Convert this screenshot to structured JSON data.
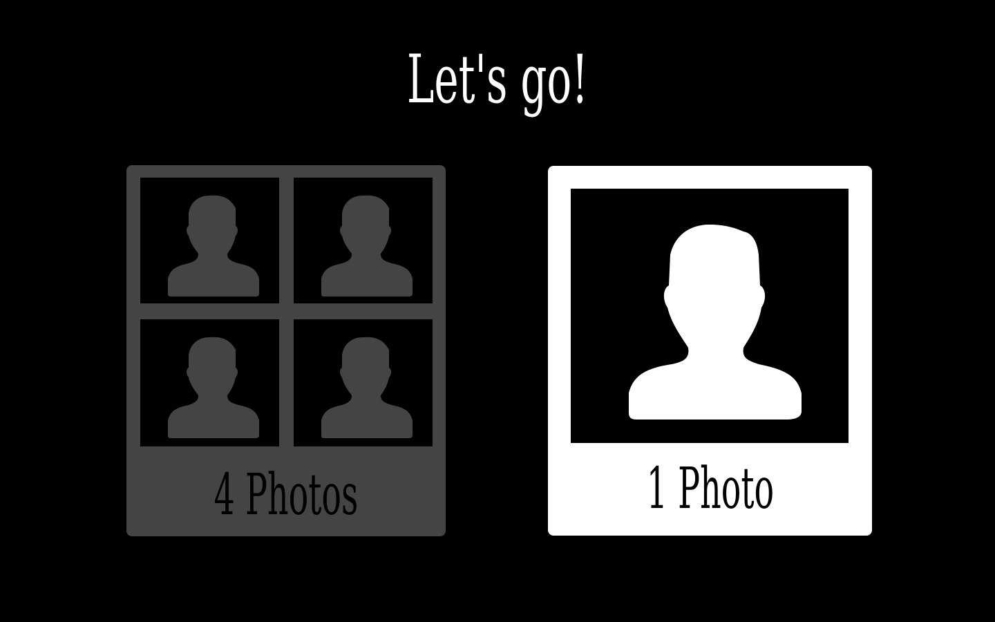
{
  "heading": "Let's go!",
  "options": [
    {
      "label": "4 Photos",
      "photo_count": 4,
      "selected": false
    },
    {
      "label": "1 Photo",
      "photo_count": 1,
      "selected": true
    }
  ],
  "colors": {
    "background": "#000000",
    "unselected": "#444444",
    "selected": "#ffffff"
  },
  "icons": [
    "person-silhouette-icon"
  ]
}
